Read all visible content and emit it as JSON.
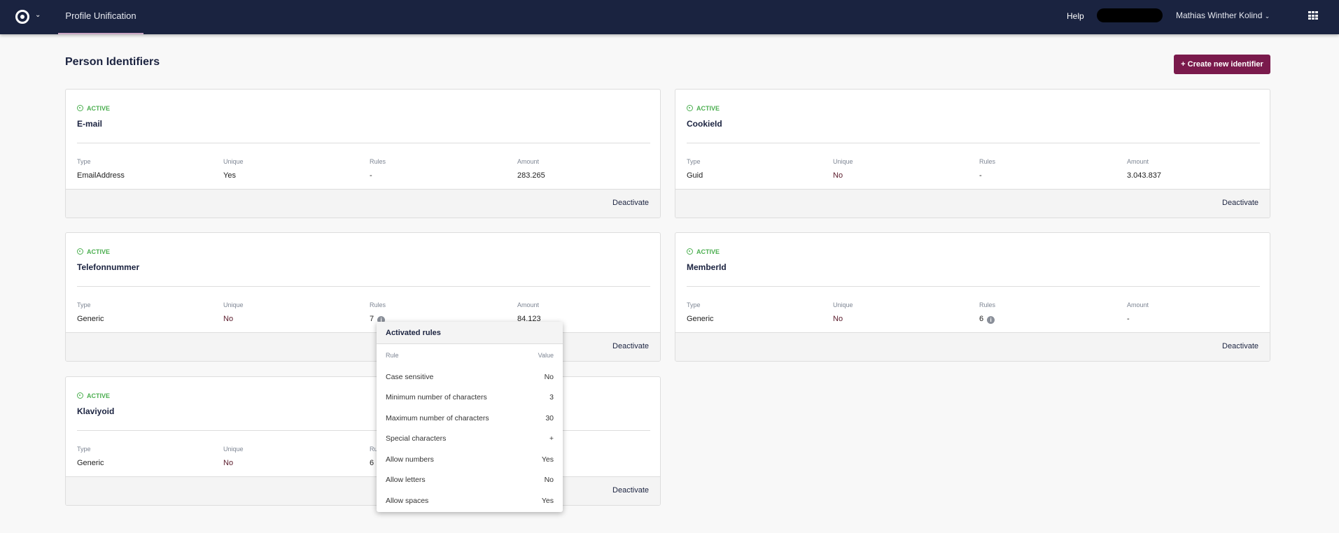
{
  "header": {
    "nav_tab": "Profile Unification",
    "help": "Help",
    "user": "Mathias Winther Kolind",
    "apps_icon": "grid-icon"
  },
  "page": {
    "title": "Person Identifiers",
    "create_button": "+ Create new identifier",
    "accent": "#7a1a4c"
  },
  "labels": {
    "type": "Type",
    "unique": "Unique",
    "rules": "Rules",
    "amount": "Amount",
    "deactivate": "Deactivate"
  },
  "cards": [
    {
      "status": "ACTIVE",
      "name": "E-mail",
      "type": "EmailAddress",
      "unique": "Yes",
      "rules": "-",
      "amount": "283.265"
    },
    {
      "status": "ACTIVE",
      "name": "CookieId",
      "type": "Guid",
      "unique": "No",
      "rules": "-",
      "amount": "3.043.837"
    },
    {
      "status": "ACTIVE",
      "name": "Telefonnummer",
      "type": "Generic",
      "unique": "No",
      "rules": "7",
      "amount": "84.123"
    },
    {
      "status": "ACTIVE",
      "name": "MemberId",
      "type": "Generic",
      "unique": "No",
      "rules": "6",
      "amount": "-"
    },
    {
      "status": "ACTIVE",
      "name": "Klaviyoid",
      "type": "Generic",
      "unique": "No",
      "rules": "6",
      "amount": ""
    }
  ],
  "popup": {
    "title": "Activated rules",
    "col_rule": "Rule",
    "col_value": "Value",
    "rows": [
      {
        "rule": "Case sensitive",
        "value": "No"
      },
      {
        "rule": "Minimum number of characters",
        "value": "3"
      },
      {
        "rule": "Maximum number of characters",
        "value": "30"
      },
      {
        "rule": "Special characters",
        "value": "+"
      },
      {
        "rule": "Allow numbers",
        "value": "Yes"
      },
      {
        "rule": "Allow letters",
        "value": "No"
      },
      {
        "rule": "Allow spaces",
        "value": "Yes"
      }
    ]
  }
}
